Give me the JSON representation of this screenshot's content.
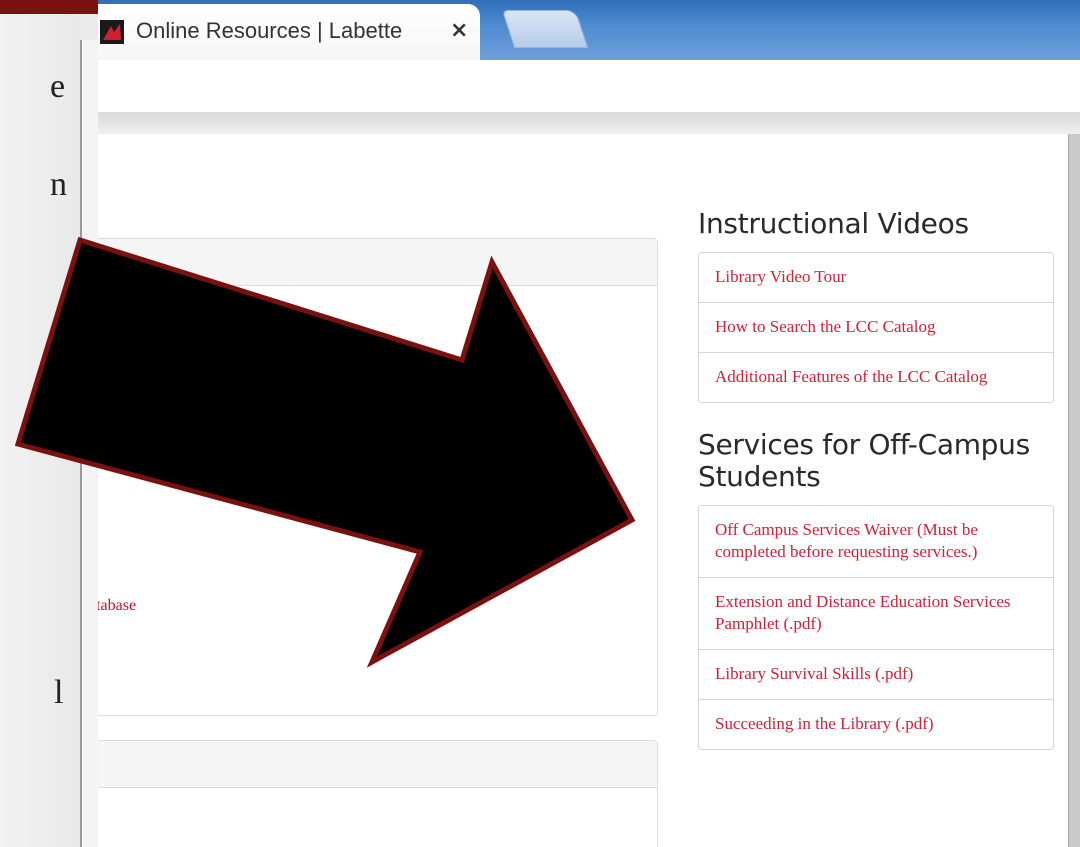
{
  "slide": {
    "left_fragments": [
      "e",
      "n",
      "l"
    ]
  },
  "browser": {
    "tab": {
      "title": "Online Resources | Labette",
      "close_glyph": "×"
    }
  },
  "main": {
    "partial_link": "atabase"
  },
  "sidebar": {
    "instructional_heading": "Instructional Videos",
    "instructional_items": [
      {
        "label": "Library Video Tour"
      },
      {
        "label": "How to Search the LCC Catalog"
      },
      {
        "label": "Additional Features of the LCC Catalog"
      }
    ],
    "services_heading": "Services for Off-Campus Students",
    "services_items": [
      {
        "label": "Off Campus Services Waiver (Must be completed before requesting services.)"
      },
      {
        "label": "Extension and Distance Education Services Pamphlet (.pdf)"
      },
      {
        "label": "Library Survival Skills (.pdf)"
      },
      {
        "label": "Succeeding in the Library (.pdf)"
      }
    ]
  },
  "colors": {
    "link": "#d0213a",
    "arrow_fill": "#000000",
    "arrow_outline": "#7a1010",
    "slide_band": "#7a1010",
    "tabbar": "#4d8ad0"
  },
  "icons": {
    "favicon": "labette-favicon-icon",
    "close": "close-icon",
    "arrow": "pointer-arrow-icon"
  }
}
